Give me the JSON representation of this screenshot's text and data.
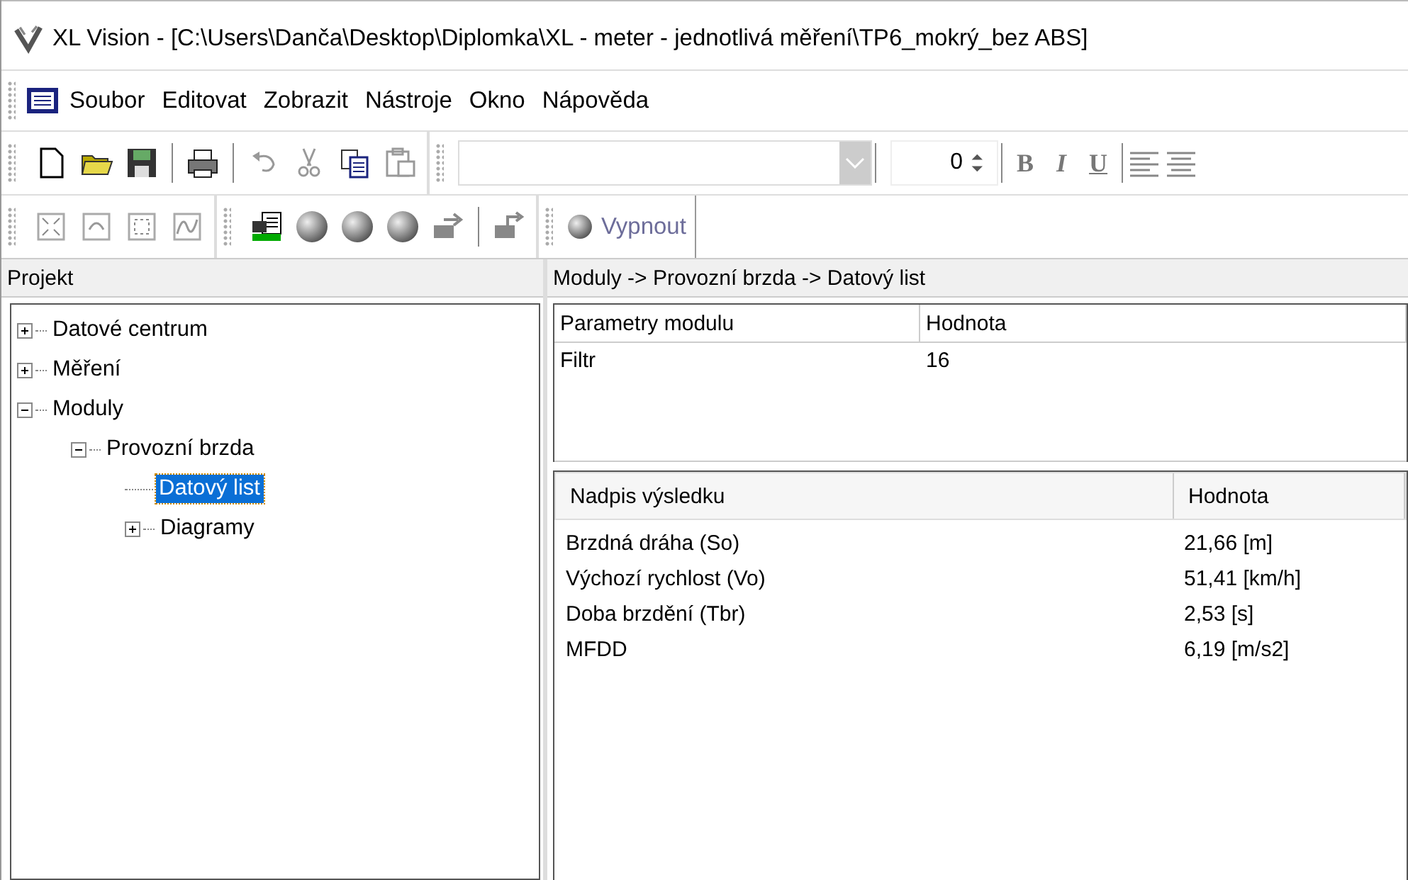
{
  "window": {
    "title": "XL Vision - [C:\\Users\\Danča\\Desktop\\Diplomka\\XL - meter - jednotlivá měření\\TP6_mokrý_bez ABS]"
  },
  "menu": [
    "Soubor",
    "Editovat",
    "Zobrazit",
    "Nástroje",
    "Okno",
    "Nápověda"
  ],
  "format_toolbar": {
    "font_size": "0",
    "style_buttons": [
      "B",
      "I",
      "U"
    ]
  },
  "power_button": {
    "label": "Vypnout",
    "disabled": true
  },
  "project_panel": {
    "title": "Projekt",
    "tree": [
      {
        "label": "Datové centrum",
        "expanded": false,
        "selected": false
      },
      {
        "label": "Měření",
        "expanded": false,
        "selected": false
      },
      {
        "label": "Moduly",
        "expanded": true,
        "selected": false,
        "children": [
          {
            "label": "Provozní brzda",
            "expanded": true,
            "selected": false,
            "children": [
              {
                "label": "Datový list",
                "selected": true
              },
              {
                "label": "Diagramy",
                "expanded": false,
                "selected": false
              }
            ]
          }
        ]
      }
    ]
  },
  "content": {
    "breadcrumb": "Moduly -> Provozní brzda -> Datový list",
    "params_table": {
      "columns": [
        "Parametry modulu",
        "Hodnota"
      ],
      "rows": [
        [
          "Filtr",
          "16"
        ]
      ]
    },
    "results_table": {
      "columns": [
        "Nadpis výsledku",
        "Hodnota"
      ],
      "rows": [
        [
          "Brzdná dráha (So)",
          "21,66 [m]"
        ],
        [
          "Výchozí rychlost (Vo)",
          "51,41 [km/h]"
        ],
        [
          "Doba brzdění (Tbr)",
          "2,53 [s]"
        ],
        [
          "MFDD",
          "6,19 [m/s2]"
        ]
      ]
    }
  }
}
